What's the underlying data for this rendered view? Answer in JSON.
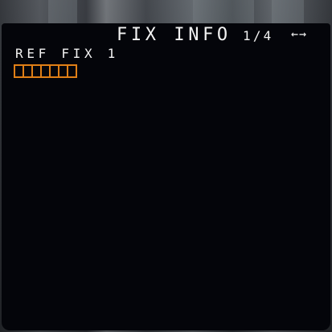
{
  "page": {
    "title": "FIX INFO",
    "page_indicator": "1/4",
    "nav_arrows": "←→"
  },
  "fields": {
    "ref_fix_label": "REF FIX 1",
    "ref_fix_value_boxes": 7
  },
  "colors": {
    "text": "#f2f2f2",
    "entry_box": "#e07f16",
    "screen_background": "#04050a"
  },
  "icons": {
    "nav_arrows": "left-right-arrows-icon"
  }
}
